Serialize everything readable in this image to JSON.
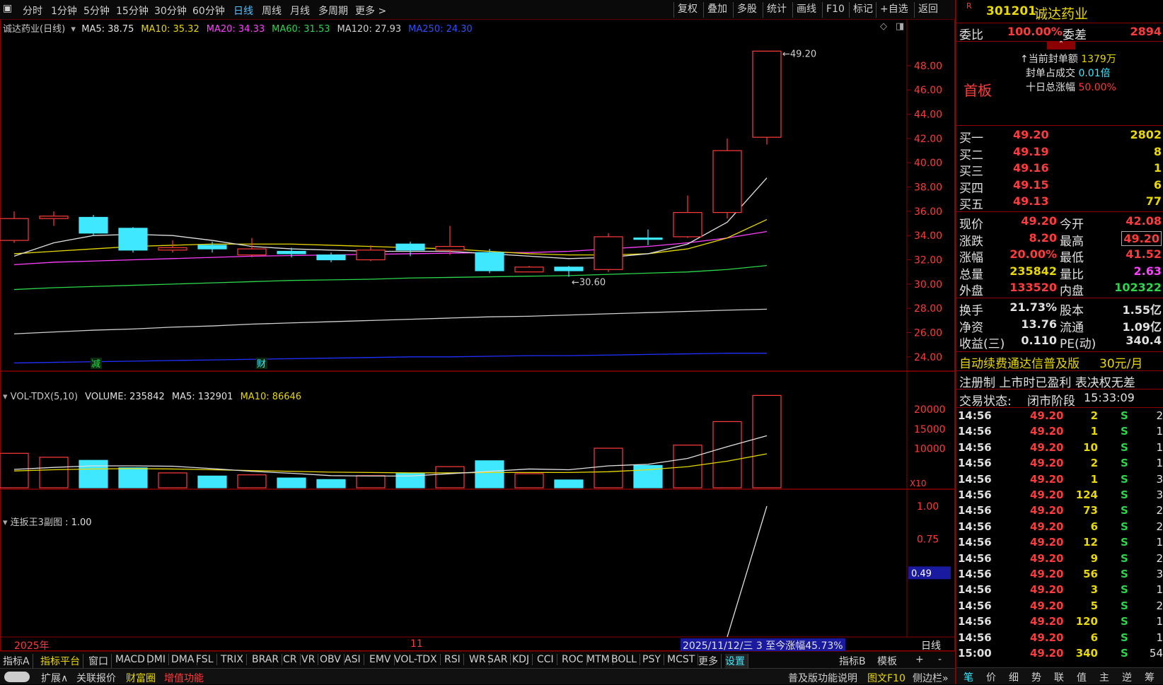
{
  "periods": [
    "分时",
    "1分钟",
    "5分钟",
    "15分钟",
    "30分钟",
    "60分钟",
    "日线",
    "周线",
    "月线",
    "多周期",
    "更多 >"
  ],
  "toolbar": [
    "复权",
    "叠加",
    "多股",
    "统计",
    "画线",
    "F10",
    "标记",
    "+自选",
    "返回"
  ],
  "menu_icon": "▣",
  "main_panel": {
    "title": "诚达药业(日线)",
    "ma": [
      {
        "label": "MA5: 38.75",
        "color": "#e0e0e0"
      },
      {
        "label": "MA10: 35.32",
        "color": "#e8d800"
      },
      {
        "label": "MA20: 34.33",
        "color": "#ff40ff"
      },
      {
        "label": "MA60: 31.53",
        "color": "#2bd64a"
      },
      {
        "label": "MA120: 27.93",
        "color": "#d0d0d0"
      },
      {
        "label": "MA250: 24.30",
        "color": "#3050ff"
      }
    ],
    "y_labels": [
      "48.00",
      "46.00",
      "44.00",
      "42.00",
      "40.00",
      "38.00",
      "36.00",
      "34.00",
      "32.00",
      "30.00",
      "28.00",
      "26.00",
      "24.00"
    ],
    "high_label": "49.20",
    "low_label": "30.60",
    "markers": [
      "减",
      "财"
    ]
  },
  "volume_panel": {
    "title": "VOL-TDX(5,10)",
    "volume": "VOLUME: 235842",
    "ma5": "MA5: 132901",
    "ma10": "MA10: 86646",
    "y_labels": [
      "20000",
      "15000",
      "10000"
    ],
    "scale": "X10"
  },
  "lbw_panel": {
    "title": "连扳王3副图",
    "value": ": 1.00",
    "y_labels": [
      "1.00",
      "0.75"
    ],
    "current": "0.49"
  },
  "axis": {
    "year": "2025年",
    "month": "11",
    "status": "2025/11/12/三 3 至今涨幅45.73%",
    "period": "日线"
  },
  "chart_data": {
    "type": "candlestick",
    "ylim": [
      23.0,
      50.5
    ],
    "candles": [
      {
        "o": 33.6,
        "c": 35.4,
        "h": 36.0,
        "l": 33.4,
        "up": true
      },
      {
        "o": 35.4,
        "c": 35.6,
        "h": 36.0,
        "l": 34.8,
        "up": true
      },
      {
        "o": 35.5,
        "c": 34.2,
        "h": 35.7,
        "l": 34.0,
        "up": false
      },
      {
        "o": 34.6,
        "c": 32.8,
        "h": 34.7,
        "l": 32.6,
        "up": false
      },
      {
        "o": 32.8,
        "c": 33.0,
        "h": 33.6,
        "l": 32.6,
        "up": true
      },
      {
        "o": 33.2,
        "c": 32.9,
        "h": 33.5,
        "l": 32.6,
        "up": false
      },
      {
        "o": 32.4,
        "c": 32.9,
        "h": 33.8,
        "l": 32.2,
        "up": true
      },
      {
        "o": 32.7,
        "c": 32.5,
        "h": 33.0,
        "l": 32.2,
        "up": false
      },
      {
        "o": 32.4,
        "c": 32.0,
        "h": 32.6,
        "l": 31.8,
        "up": false
      },
      {
        "o": 32.0,
        "c": 32.8,
        "h": 33.2,
        "l": 31.9,
        "up": true
      },
      {
        "o": 33.3,
        "c": 32.8,
        "h": 33.5,
        "l": 32.3,
        "up": false
      },
      {
        "o": 32.8,
        "c": 33.1,
        "h": 34.8,
        "l": 32.4,
        "up": true
      },
      {
        "o": 32.6,
        "c": 31.1,
        "h": 32.9,
        "l": 30.9,
        "up": false
      },
      {
        "o": 31.0,
        "c": 31.4,
        "h": 31.5,
        "l": 31.0,
        "up": true
      },
      {
        "o": 31.4,
        "c": 31.1,
        "h": 31.5,
        "l": 30.6,
        "up": false
      },
      {
        "o": 31.2,
        "c": 33.9,
        "h": 34.2,
        "l": 31.0,
        "up": true
      },
      {
        "o": 33.8,
        "c": 33.7,
        "h": 34.5,
        "l": 33.2,
        "up": false
      },
      {
        "o": 33.9,
        "c": 35.9,
        "h": 37.3,
        "l": 33.8,
        "up": true
      },
      {
        "o": 35.9,
        "c": 41.0,
        "h": 42.0,
        "l": 35.4,
        "up": true
      },
      {
        "o": 42.1,
        "c": 49.2,
        "h": 49.2,
        "l": 41.5,
        "up": true
      }
    ],
    "ma5": [
      32.3,
      33.4,
      34.0,
      34.1,
      34.0,
      33.6,
      33.1,
      32.9,
      32.8,
      32.7,
      32.7,
      32.7,
      32.5,
      32.3,
      32.1,
      32.2,
      32.5,
      33.3,
      35.1,
      38.75
    ],
    "ma10": [
      32.5,
      32.7,
      32.9,
      33.1,
      33.2,
      33.3,
      33.3,
      33.3,
      33.2,
      33.1,
      33.0,
      32.9,
      32.7,
      32.5,
      32.4,
      32.4,
      32.5,
      32.9,
      33.8,
      35.32
    ],
    "ma20": [
      31.6,
      31.8,
      31.9,
      32.0,
      32.1,
      32.2,
      32.3,
      32.35,
      32.4,
      32.45,
      32.5,
      32.55,
      32.6,
      32.6,
      32.7,
      32.9,
      33.1,
      33.4,
      33.8,
      34.33
    ],
    "ma60": [
      29.55,
      29.7,
      29.8,
      29.9,
      30.0,
      30.1,
      30.2,
      30.3,
      30.35,
      30.4,
      30.5,
      30.55,
      30.6,
      30.65,
      30.7,
      30.8,
      30.9,
      31.0,
      31.2,
      31.53
    ],
    "ma120": [
      25.9,
      26.05,
      26.2,
      26.3,
      26.45,
      26.55,
      26.7,
      26.8,
      26.9,
      27.0,
      27.1,
      27.2,
      27.3,
      27.35,
      27.45,
      27.55,
      27.65,
      27.75,
      27.85,
      27.93
    ],
    "ma250": [
      23.5,
      23.55,
      23.6,
      23.65,
      23.7,
      23.75,
      23.8,
      23.85,
      23.9,
      23.95,
      24.0,
      24.0,
      24.05,
      24.1,
      24.1,
      24.15,
      24.2,
      24.25,
      24.3,
      24.3
    ],
    "volumes": [
      8800,
      7800,
      7000,
      5100,
      3800,
      3000,
      3300,
      2500,
      2100,
      3100,
      3600,
      5400,
      6900,
      3600,
      2000,
      10100,
      5700,
      10900,
      16900,
      23584
    ],
    "vol_ma5": [
      4700,
      5200,
      5600,
      5600,
      5500,
      4900,
      4200,
      3700,
      3100,
      3000,
      3000,
      3600,
      4200,
      4800,
      4600,
      5600,
      6000,
      7500,
      10500,
      13290
    ],
    "vol_ma10": [
      4300,
      4600,
      4800,
      4900,
      4800,
      4600,
      4400,
      4200,
      4000,
      3900,
      3800,
      3800,
      3900,
      3900,
      3900,
      4100,
      4600,
      5400,
      6800,
      8665
    ],
    "lbw": [
      0,
      0,
      0,
      0,
      0,
      0,
      0,
      0,
      0,
      0,
      0,
      0,
      0,
      0,
      0,
      0,
      0,
      0,
      0,
      1.0
    ],
    "colors": {
      "up": "#ff3b3b",
      "down": "#3fe8ff"
    }
  },
  "quote": {
    "code": "301201",
    "name": "诚达药业",
    "r_badge": "R",
    "weibi_label": "委比",
    "weibi_value": "100.00%",
    "weicha_label": "委差",
    "weicha_value": "2894",
    "shouban": "首板",
    "seal_amount_label": "当前封单额",
    "seal_amount": "1379万",
    "seal_ratio_label": "封单占成交",
    "seal_ratio": "0.01倍",
    "ten_day_label": "十日总涨幅",
    "ten_day": "50.00%",
    "bids": [
      {
        "label": "买一",
        "price": "49.20",
        "vol": "2802"
      },
      {
        "label": "买二",
        "price": "49.19",
        "vol": "8"
      },
      {
        "label": "买三",
        "price": "49.16",
        "vol": "1"
      },
      {
        "label": "买四",
        "price": "49.15",
        "vol": "6"
      },
      {
        "label": "买五",
        "price": "49.13",
        "vol": "77"
      }
    ],
    "stats": [
      {
        "l1": "现价",
        "v1": "49.20",
        "c1": "red",
        "l2": "今开",
        "v2": "42.08",
        "c2": "red"
      },
      {
        "l1": "涨跌",
        "v1": "8.20",
        "c1": "red",
        "l2": "最高",
        "v2": "49.20",
        "c2": "red"
      },
      {
        "l1": "涨幅",
        "v1": "20.00%",
        "c1": "red",
        "l2": "最低",
        "v2": "41.52",
        "c2": "red"
      },
      {
        "l1": "总量",
        "v1": "235842",
        "c1": "yellow",
        "l2": "量比",
        "v2": "2.63",
        "c2": "magenta"
      },
      {
        "l1": "外盘",
        "v1": "133520",
        "c1": "red",
        "l2": "内盘",
        "v2": "102322",
        "c2": "green"
      }
    ],
    "stats2": [
      {
        "l1": "换手",
        "v1": "21.73%",
        "l2": "股本",
        "v2": "1.55亿"
      },
      {
        "l1": "净资",
        "v1": "13.76",
        "l2": "流通",
        "v2": "1.09亿"
      },
      {
        "l1": "收益(三)",
        "v1": "0.110",
        "l2": "PE(动)",
        "v2": "340.4"
      }
    ],
    "ad_text": "自动续费通达信普及版",
    "ad_price": "30元/月",
    "reg_text": "注册制 上市时已盈利 表决权无差",
    "status_label": "交易状态:",
    "status_value": "闭市阶段",
    "status_time": "15:33:09",
    "ticks": [
      {
        "t": "14:56",
        "p": "49.20",
        "v": "2",
        "s": "S",
        "n": "2"
      },
      {
        "t": "14:56",
        "p": "49.20",
        "v": "1",
        "s": "S",
        "n": "1"
      },
      {
        "t": "14:56",
        "p": "49.20",
        "v": "10",
        "s": "S",
        "n": "1"
      },
      {
        "t": "14:56",
        "p": "49.20",
        "v": "2",
        "s": "S",
        "n": "1"
      },
      {
        "t": "14:56",
        "p": "49.20",
        "v": "1",
        "s": "S",
        "n": "3"
      },
      {
        "t": "14:56",
        "p": "49.20",
        "v": "124",
        "s": "S",
        "n": "3"
      },
      {
        "t": "14:56",
        "p": "49.20",
        "v": "73",
        "s": "S",
        "n": "2"
      },
      {
        "t": "14:56",
        "p": "49.20",
        "v": "6",
        "s": "S",
        "n": "2"
      },
      {
        "t": "14:56",
        "p": "49.20",
        "v": "12",
        "s": "S",
        "n": "1"
      },
      {
        "t": "14:56",
        "p": "49.20",
        "v": "9",
        "s": "S",
        "n": "2"
      },
      {
        "t": "14:56",
        "p": "49.20",
        "v": "56",
        "s": "S",
        "n": "3"
      },
      {
        "t": "14:56",
        "p": "49.20",
        "v": "3",
        "s": "S",
        "n": "1"
      },
      {
        "t": "14:56",
        "p": "49.20",
        "v": "5",
        "s": "S",
        "n": "2"
      },
      {
        "t": "14:56",
        "p": "49.20",
        "v": "120",
        "s": "S",
        "n": "1"
      },
      {
        "t": "14:56",
        "p": "49.20",
        "v": "6",
        "s": "S",
        "n": "1"
      },
      {
        "t": "15:00",
        "p": "49.20",
        "v": "340",
        "s": "S",
        "n": "54"
      }
    ],
    "bottom_tabs": [
      "笔",
      "价",
      "细",
      "势",
      "联",
      "值",
      "主",
      "逆",
      "筹"
    ]
  },
  "indicator_tabs": [
    "指标A",
    "指标平台",
    "窗口",
    "MACD",
    "DMI",
    "DMA",
    "FSL",
    "TRIX",
    "BRAR",
    "CR",
    "VR",
    "OBV",
    "ASI",
    "EMV",
    "VOL-TDX",
    "RSI",
    "WR",
    "SAR",
    "KDJ",
    "CCI",
    "ROC",
    "MTM",
    "BOLL",
    "PSY",
    "MCST",
    "更多",
    "设置"
  ],
  "indicator_right": [
    "指标B",
    "模板",
    "+",
    "-"
  ],
  "footer_left": [
    "扩展∧",
    "关联报价",
    "财富圈",
    "增值功能"
  ],
  "footer_right": [
    "普及版功能说明",
    "图文F10",
    "侧边栏»"
  ]
}
